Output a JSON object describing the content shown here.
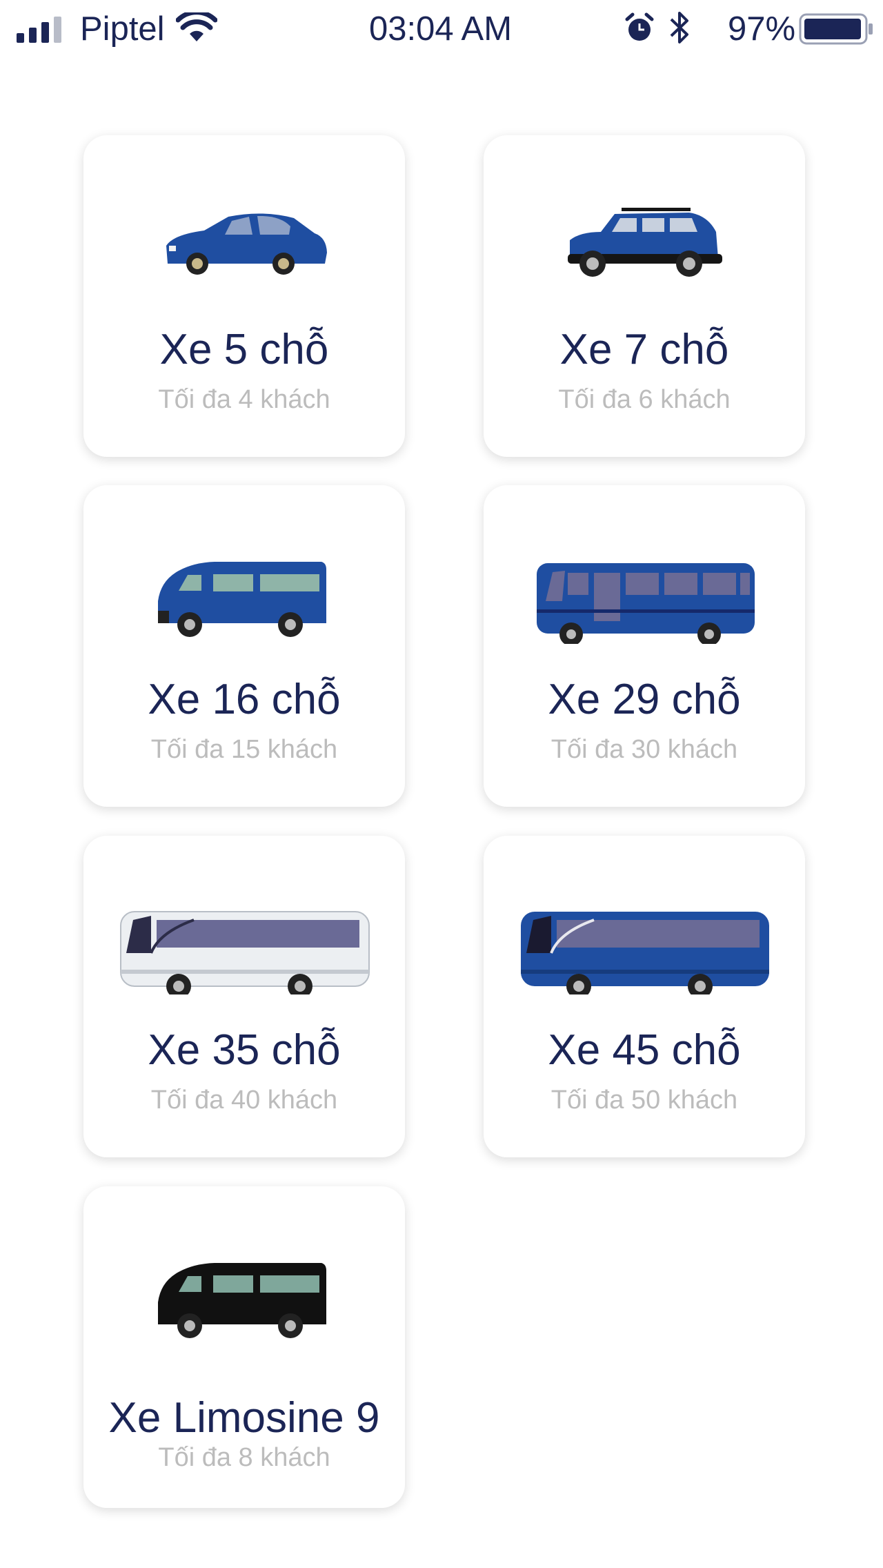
{
  "status_bar": {
    "carrier": "Piptel",
    "time": "03:04 AM",
    "battery_percent": "97%",
    "icons": [
      "signal-icon",
      "wifi-icon",
      "alarm-icon",
      "bluetooth-icon",
      "battery-icon"
    ]
  },
  "vehicles": [
    {
      "title": "Xe 5 chỗ",
      "subtitle": "Tối đa 4 khách",
      "icon": "sedan-icon"
    },
    {
      "title": "Xe 7 chỗ",
      "subtitle": "Tối đa 6 khách",
      "icon": "suv-icon"
    },
    {
      "title": "Xe 16 chỗ",
      "subtitle": "Tối đa 15 khách",
      "icon": "van-icon"
    },
    {
      "title": "Xe 29 chỗ",
      "subtitle": "Tối đa 30 khách",
      "icon": "minibus-icon"
    },
    {
      "title": "Xe 35 chỗ",
      "subtitle": "Tối đa 40 khách",
      "icon": "white-coach-icon"
    },
    {
      "title": "Xe 45 chỗ",
      "subtitle": "Tối đa 50 khách",
      "icon": "blue-coach-icon"
    },
    {
      "title": "Xe Limosine 9",
      "subtitle": "Tối đa 8 khách",
      "icon": "black-limousine-van-icon"
    }
  ],
  "colors": {
    "text_primary": "#1b2556",
    "text_secondary": "#bcbcbc",
    "vehicle_blue": "#1f4ea1",
    "limousine_black": "#111111"
  }
}
